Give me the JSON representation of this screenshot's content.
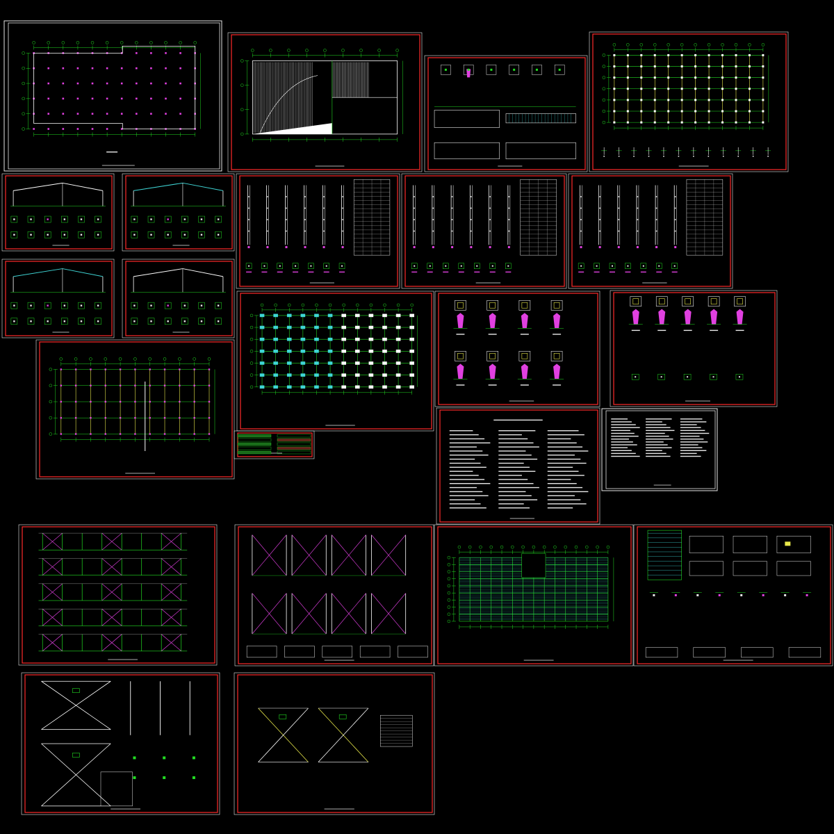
{
  "colors": {
    "background": "#000000",
    "sheet_border": "#ff2a2a",
    "sheet_border_white": "#e8e8e8",
    "grid": "#22dd22",
    "column": "#ffffff",
    "beam_yellow": "#e8e84a",
    "bracing": "#d23cd2",
    "highlight_cyan": "#3fd6d6",
    "highlight_magenta": "#e040e0",
    "text": "#e8e8e8"
  },
  "sheets": [
    {
      "id": "foundation-plan"
    },
    {
      "id": "roof-plan"
    },
    {
      "id": "foundation-details"
    },
    {
      "id": "column-grid-plan"
    },
    {
      "id": "frame-elevation-1"
    },
    {
      "id": "frame-elevation-2"
    },
    {
      "id": "column-schedule-1"
    },
    {
      "id": "column-schedule-2"
    },
    {
      "id": "column-schedule-3"
    },
    {
      "id": "frame-elevation-3"
    },
    {
      "id": "frame-elevation-4"
    },
    {
      "id": "roof-beam-plan"
    },
    {
      "id": "column-layout-plan"
    },
    {
      "id": "base-plate-details-1"
    },
    {
      "id": "base-plate-details-2"
    },
    {
      "id": "purlin-plan"
    },
    {
      "id": "legend-sheet"
    },
    {
      "id": "design-notes"
    },
    {
      "id": "material-notes"
    },
    {
      "id": "wall-bracing-elevations"
    },
    {
      "id": "bracing-details"
    },
    {
      "id": "roof-purlin-layout"
    },
    {
      "id": "connection-details"
    },
    {
      "id": "x-bracing-details-1"
    },
    {
      "id": "x-bracing-details-2"
    }
  ]
}
